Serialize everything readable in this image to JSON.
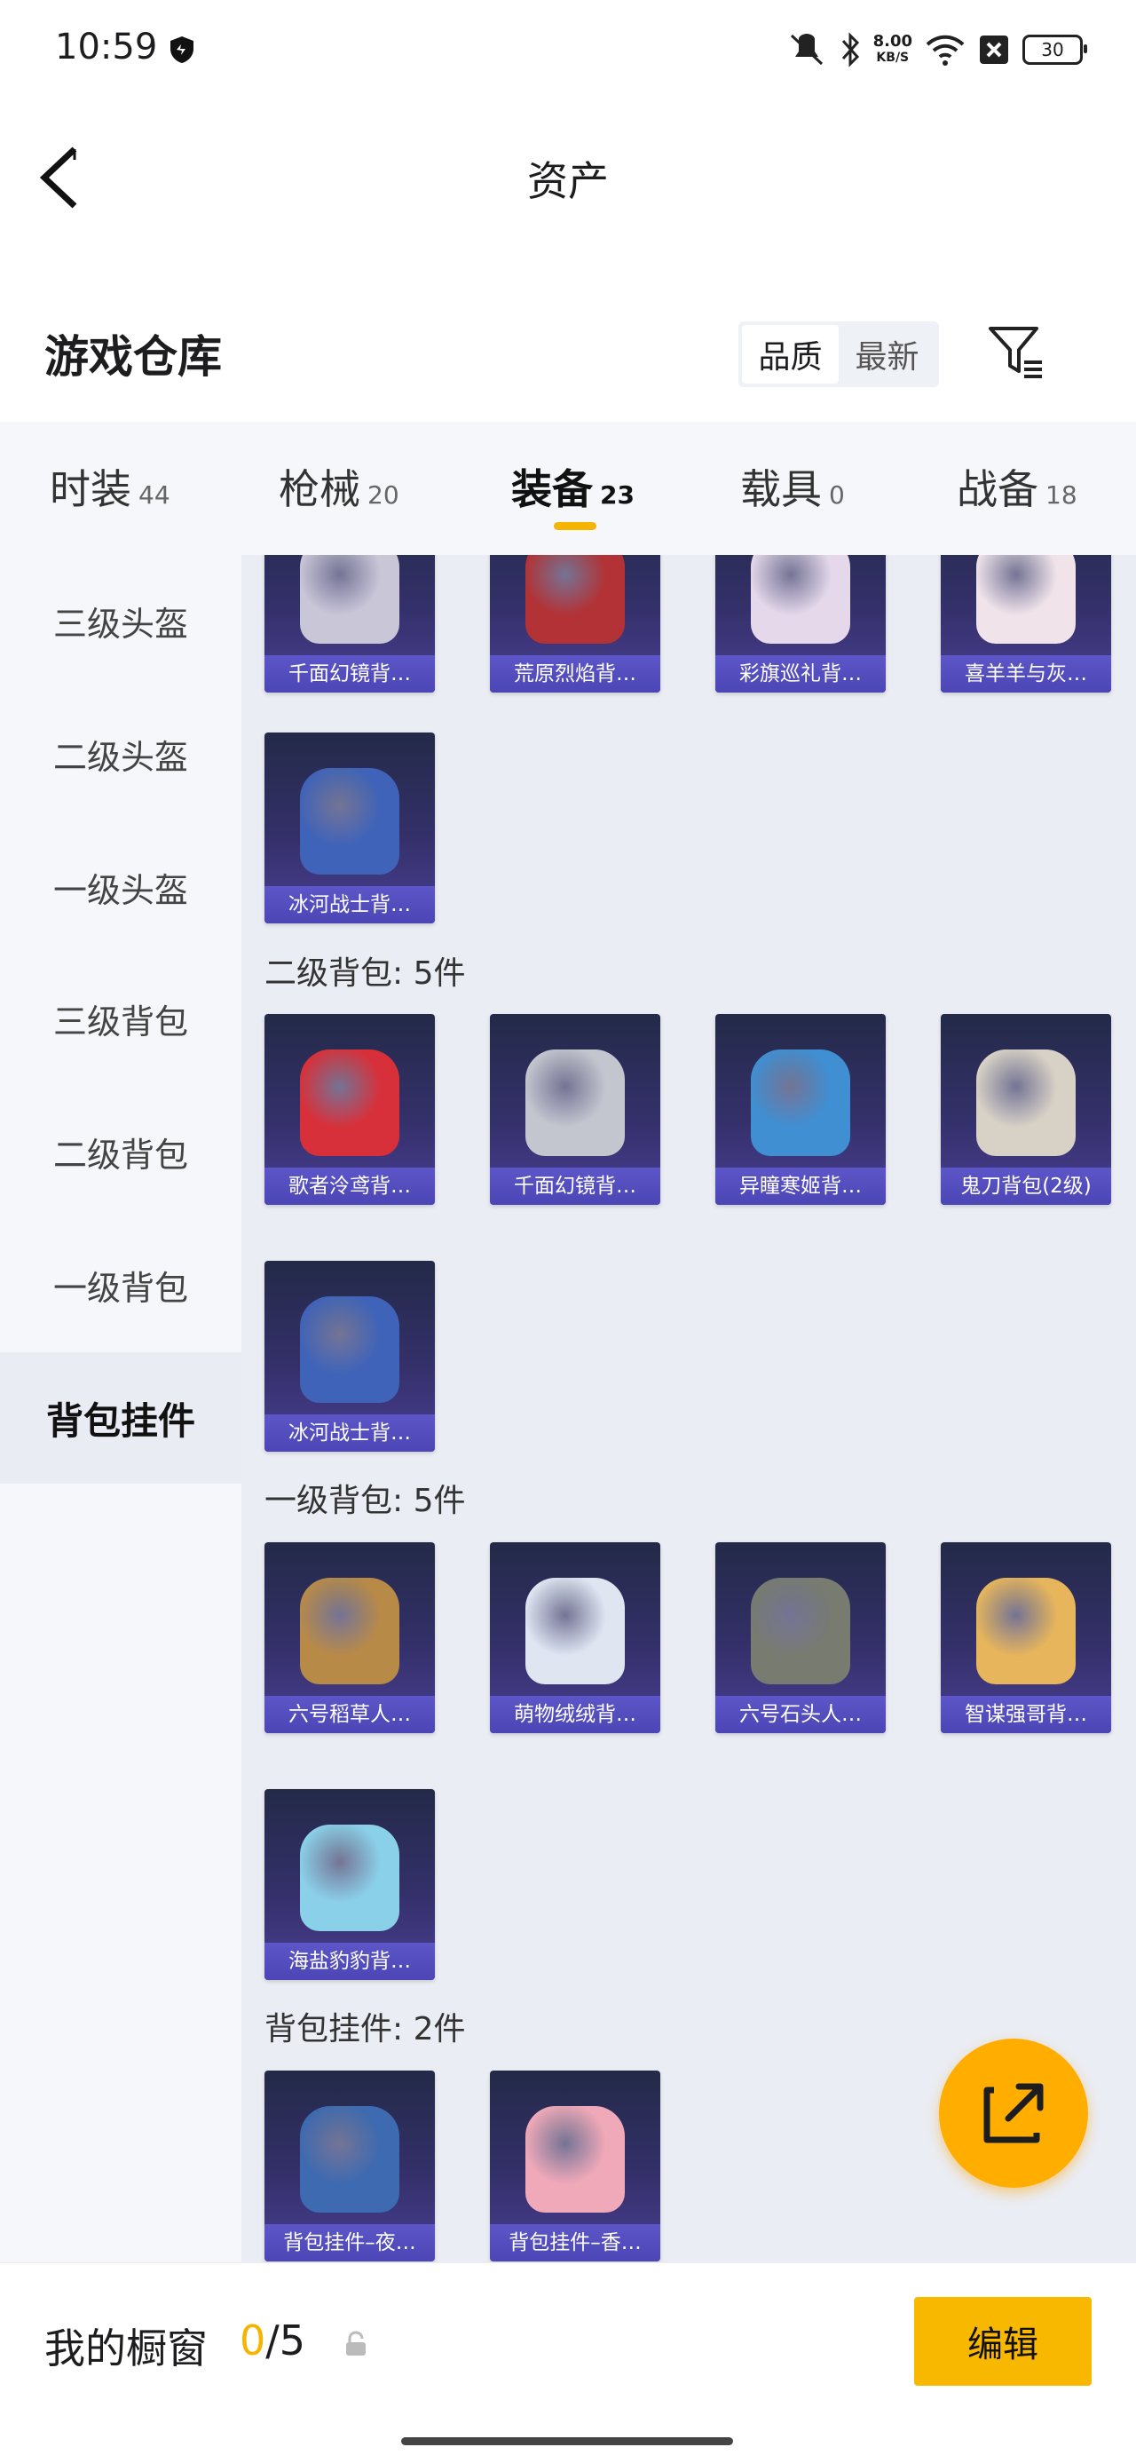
{
  "status_bar": {
    "time": "10:59",
    "speed_value": "8.00",
    "speed_unit": "KB/S",
    "battery": "30"
  },
  "nav": {
    "title": "资产"
  },
  "warehouse": {
    "title": "游戏仓库",
    "sort_options": [
      "品质",
      "最新"
    ],
    "sort_active": 0
  },
  "tabs": [
    {
      "label": "时装",
      "count": "44",
      "active": false
    },
    {
      "label": "枪械",
      "count": "20",
      "active": false
    },
    {
      "label": "装备",
      "count": "23",
      "active": true
    },
    {
      "label": "载具",
      "count": "0",
      "active": false
    },
    {
      "label": "战备",
      "count": "18",
      "active": false
    }
  ],
  "sidebar": [
    {
      "label": "三级头盔",
      "active": false
    },
    {
      "label": "二级头盔",
      "active": false
    },
    {
      "label": "一级头盔",
      "active": false
    },
    {
      "label": "三级背包",
      "active": false
    },
    {
      "label": "二级背包",
      "active": false
    },
    {
      "label": "一级背包",
      "active": false
    },
    {
      "label": "背包挂件",
      "active": true
    }
  ],
  "sections": [
    {
      "title": "",
      "items": [
        {
          "name": "千面幻镜背…",
          "color": "#c9c6d8"
        },
        {
          "name": "荒原烈焰背…",
          "color": "#b23235"
        },
        {
          "name": "彩旗巡礼背…",
          "color": "#e4d8ea"
        },
        {
          "name": "喜羊羊与灰…",
          "color": "#f0e4ea"
        },
        {
          "name": "冰河战士背…",
          "color": "#3f63b8"
        }
      ]
    },
    {
      "title": "二级背包: 5件",
      "items": [
        {
          "name": "歌者泠鸢背…",
          "color": "#d8303a"
        },
        {
          "name": "千面幻镜背…",
          "color": "#c4c6cf"
        },
        {
          "name": "异瞳寒姬背…",
          "color": "#3f8fd2"
        },
        {
          "name": "鬼刀背包(2级)",
          "color": "#d8d2c6"
        },
        {
          "name": "冰河战士背…",
          "color": "#3f63b8"
        }
      ]
    },
    {
      "title": "一级背包: 5件",
      "items": [
        {
          "name": "六号稻草人…",
          "color": "#b88a48"
        },
        {
          "name": "萌物绒绒背…",
          "color": "#dfe6f2"
        },
        {
          "name": "六号石头人…",
          "color": "#777b70"
        },
        {
          "name": "智谋强哥背…",
          "color": "#e6b55c"
        },
        {
          "name": "海盐豹豹背…",
          "color": "#8ad0e8"
        }
      ]
    },
    {
      "title": "背包挂件: 2件",
      "items": [
        {
          "name": "背包挂件–夜…",
          "color": "#3d6ab0"
        },
        {
          "name": "背包挂件–香…",
          "color": "#f0a9b8"
        }
      ]
    }
  ],
  "bottom_bar": {
    "label": "我的橱窗",
    "current": "0",
    "separator": "/",
    "total": "5",
    "edit_label": "编辑"
  },
  "colors": {
    "accent": "#f9b800",
    "card_label": "#5c56c8"
  }
}
